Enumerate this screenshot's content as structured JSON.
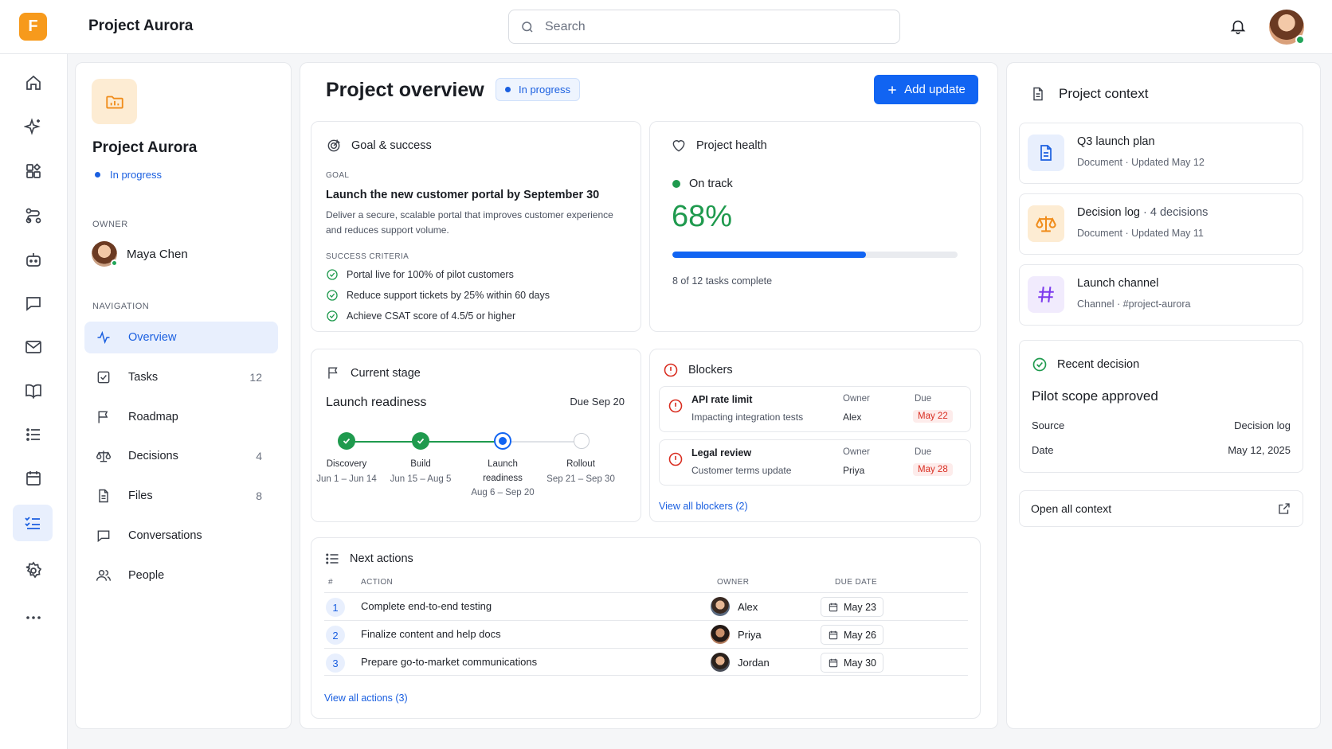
{
  "app": {
    "logo_letter": "F",
    "title": "Project Aurora",
    "brand_color": "#f79a1c"
  },
  "search": {
    "placeholder": "Search"
  },
  "rail": {
    "icons": [
      "home-icon",
      "sparkle-icon",
      "apps-icon",
      "workflow-icon",
      "bot-icon",
      "chat-icon",
      "mail-icon",
      "book-icon",
      "list-icon",
      "calendar-icon",
      "checklist-icon",
      "gear-icon",
      "more-icon"
    ],
    "active": "checklist-icon"
  },
  "left": {
    "project_name": "Project Aurora",
    "status": "In progress",
    "owner_label": "OWNER",
    "owner_name": "Maya Chen",
    "nav_label": "NAVIGATION",
    "nav": [
      {
        "label": "Overview",
        "count": "",
        "icon": "activity-icon",
        "active": true
      },
      {
        "label": "Tasks",
        "count": "12",
        "icon": "checkbox-icon"
      },
      {
        "label": "Roadmap",
        "count": "",
        "icon": "flag-icon"
      },
      {
        "label": "Decisions",
        "count": "4",
        "icon": "scale-icon"
      },
      {
        "label": "Files",
        "count": "8",
        "icon": "file-icon"
      },
      {
        "label": "Conversations",
        "count": "",
        "icon": "chat-icon"
      },
      {
        "label": "People",
        "count": "",
        "icon": "people-icon"
      }
    ]
  },
  "main": {
    "title": "Project overview",
    "status": "In progress",
    "add_button": "Add update",
    "goal": {
      "header": "Goal & success",
      "goal_label": "GOAL",
      "goal_title": "Launch the new customer portal by September 30",
      "goal_desc": "Deliver a secure, scalable portal that improves customer experience and reduces support volume.",
      "criteria_label": "SUCCESS CRITERIA",
      "criteria": [
        "Portal live for 100% of pilot customers",
        "Reduce support tickets by 25% within 60 days",
        "Achieve CSAT score of 4.5/5 or higher"
      ]
    },
    "health": {
      "header": "Project health",
      "status": "On track",
      "percent_label": "68%",
      "progress": 0.68,
      "tasks_text": "8 of 12 tasks complete"
    },
    "stage": {
      "header": "Current stage",
      "name": "Launch readiness",
      "due": "Due Sep 20",
      "steps": [
        {
          "label": "Discovery",
          "dates": "Jun 1 – Jun 14",
          "state": "done"
        },
        {
          "label": "Build",
          "dates": "Jun 15 – Aug 5",
          "state": "done"
        },
        {
          "label": "Launch readiness",
          "dates": "Aug 6 – Sep 20",
          "state": "current"
        },
        {
          "label": "Rollout",
          "dates": "Sep 21 – Sep 30",
          "state": "upcoming"
        }
      ]
    },
    "blockers": {
      "header": "Blockers",
      "owner_label": "Owner",
      "due_label": "Due",
      "items": [
        {
          "title": "API rate limit",
          "sub": "Impacting integration tests",
          "owner": "Alex",
          "due": "May 22"
        },
        {
          "title": "Legal review",
          "sub": "Customer terms update",
          "owner": "Priya",
          "due": "May 28"
        }
      ],
      "link": "View all blockers (2)"
    },
    "next": {
      "header": "Next actions",
      "cols": {
        "num": "#",
        "action": "ACTION",
        "owner": "OWNER",
        "due": "DUE DATE"
      },
      "rows": [
        {
          "num": "1",
          "action": "Complete end-to-end testing",
          "owner": "Alex",
          "due": "May 23"
        },
        {
          "num": "2",
          "action": "Finalize content and help docs",
          "owner": "Priya",
          "due": "May 26"
        },
        {
          "num": "3",
          "action": "Prepare go-to-market communications",
          "owner": "Jordan",
          "due": "May 30"
        }
      ],
      "link": "View all actions (3)"
    }
  },
  "right": {
    "header": "Project context",
    "items": [
      {
        "title": "Q3 launch plan",
        "extra": "",
        "sub": "Document · Updated May 12",
        "icon": "document-icon",
        "color": "#1a5fe0"
      },
      {
        "title": "Decision log",
        "extra": "· 4 decisions",
        "sub": "Document · Updated May 11",
        "icon": "scale-icon",
        "color": "#f08c1a"
      },
      {
        "title": "Launch channel",
        "extra": "",
        "sub": "Channel · #project-aurora",
        "icon": "hash-icon",
        "color": "#7c3aed"
      }
    ],
    "decision": {
      "header": "Recent decision",
      "title": "Pilot scope approved",
      "source_label": "Source",
      "source": "Decision log",
      "date_label": "Date",
      "date": "May 12, 2025"
    },
    "open_all": "Open all context"
  }
}
